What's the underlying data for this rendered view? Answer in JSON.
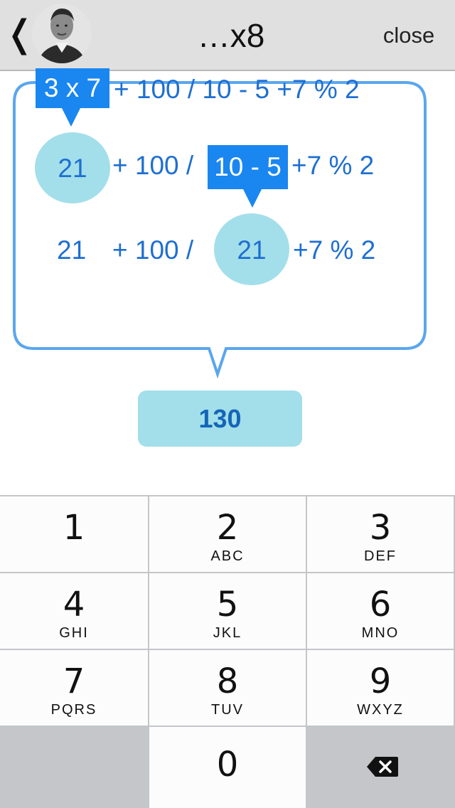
{
  "header": {
    "back_icon": "❬",
    "title": "…x8",
    "close_label": "close"
  },
  "bubble": {
    "row1": {
      "highlight": "3 x 7",
      "rest": "+ 100 / 10 - 5 +7 % 2"
    },
    "row2": {
      "circle": "21",
      "mid": "+ 100 /",
      "highlight": "10 - 5",
      "rest": "+7 % 2"
    },
    "row3": {
      "first": "21",
      "mid": "+ 100 /",
      "circle": "21",
      "rest": "+7 % 2"
    }
  },
  "result": {
    "value": "130"
  },
  "keypad": {
    "keys": [
      {
        "digit": "1",
        "letters": ""
      },
      {
        "digit": "2",
        "letters": "ABC"
      },
      {
        "digit": "3",
        "letters": "DEF"
      },
      {
        "digit": "4",
        "letters": "GHI"
      },
      {
        "digit": "5",
        "letters": "JKL"
      },
      {
        "digit": "6",
        "letters": "MNO"
      },
      {
        "digit": "7",
        "letters": "PQRS"
      },
      {
        "digit": "8",
        "letters": "TUV"
      },
      {
        "digit": "9",
        "letters": "WXYZ"
      },
      {
        "digit": "0",
        "letters": ""
      }
    ],
    "delete_icon": "backspace-icon"
  },
  "colors": {
    "accent_blue": "#1a86f0",
    "text_blue": "#1e6fd0",
    "bubble_fill": "#a3dfea",
    "bubble_border": "#5aa6ee"
  }
}
